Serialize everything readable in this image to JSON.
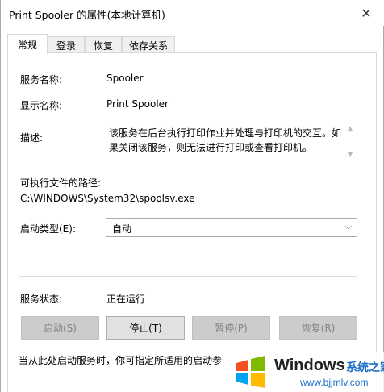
{
  "window": {
    "title": "Print Spooler 的属性(本地计算机)",
    "close_glyph": "✕"
  },
  "tabs": [
    {
      "label": "常规",
      "active": true
    },
    {
      "label": "登录",
      "active": false
    },
    {
      "label": "恢复",
      "active": false
    },
    {
      "label": "依存关系",
      "active": false
    }
  ],
  "general": {
    "service_name_label": "服务名称:",
    "service_name_value": "Spooler",
    "display_name_label": "显示名称:",
    "display_name_value": "Print Spooler",
    "description_label": "描述:",
    "description_value": "该服务在后台执行打印作业并处理与打印机的交互。如果关闭该服务，则无法进行打印或查看打印机。",
    "exec_path_label": "可执行文件的路径:",
    "exec_path_value": "C:\\WINDOWS\\System32\\spoolsv.exe",
    "startup_type_label": "启动类型(E):",
    "startup_type_value": "自动",
    "service_status_label": "服务状态:",
    "service_status_value": "正在运行",
    "footer_text": "当从此处启动服务时，你可指定所适用的启动参"
  },
  "buttons": {
    "start": "启动(S)",
    "stop": "停止(T)",
    "pause": "暂停(P)",
    "resume": "恢复(R)"
  },
  "watermark": {
    "brand": "Windows",
    "cn": "系统之家",
    "url": "www.bjjmlv.com"
  },
  "colors": {
    "watermark_blue": "#1f6fc5",
    "disabled_text": "#838383"
  }
}
